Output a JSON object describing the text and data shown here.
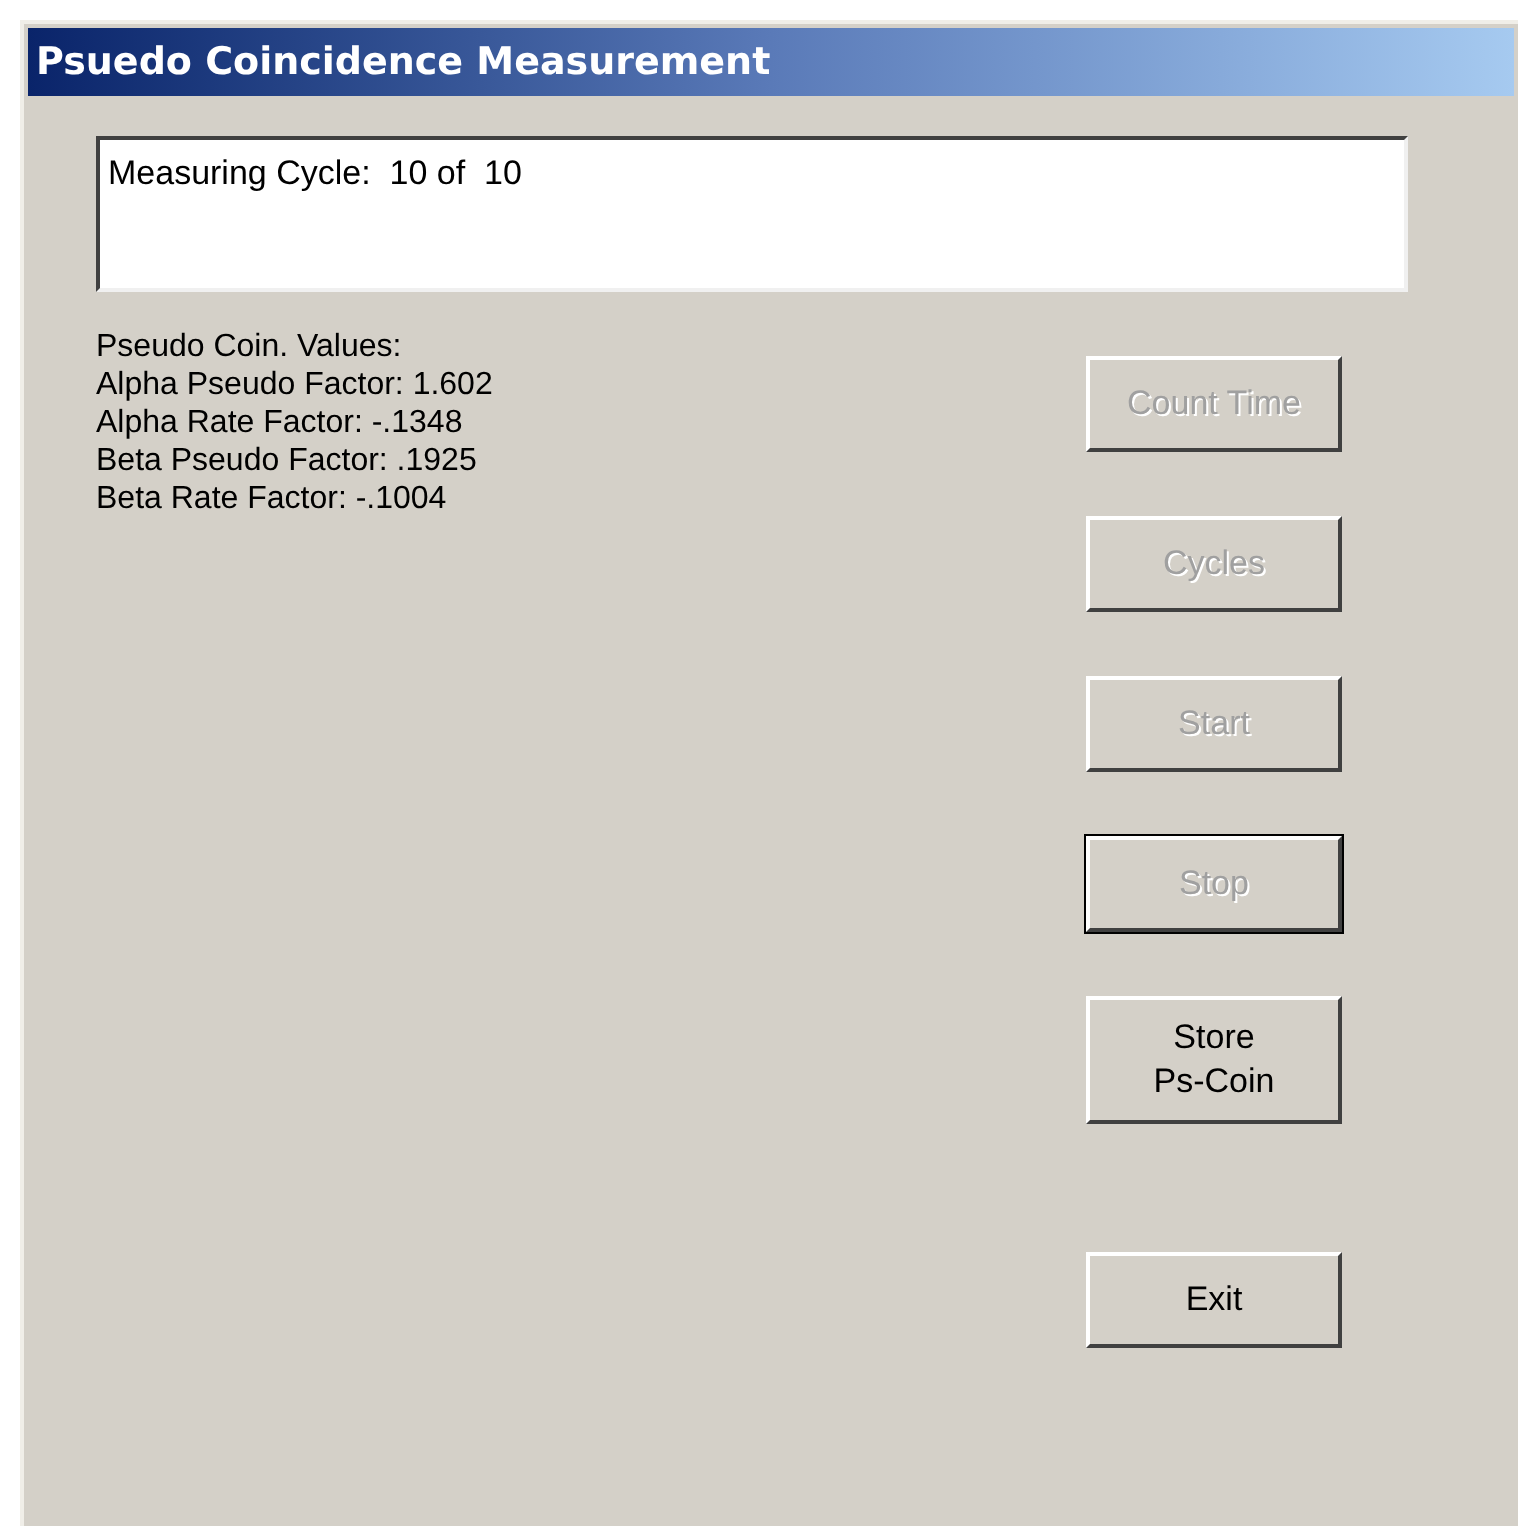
{
  "window": {
    "title": "Psuedo Coincidence Measurement"
  },
  "status_box": {
    "text": "Measuring Cycle:  10 of  10"
  },
  "values": [
    "Pseudo Coin. Values:",
    "Alpha Pseudo Factor: 1.602",
    "Alpha Rate Factor: -.1348",
    "Beta Pseudo Factor: .1925",
    "Beta Rate Factor: -.1004"
  ],
  "button_groups": [
    [
      {
        "label": "Count Time",
        "disabled": true,
        "default": false
      },
      {
        "label": "Cycles",
        "disabled": true,
        "default": false
      },
      {
        "label": "Start",
        "disabled": true,
        "default": false
      },
      {
        "label": "Stop",
        "disabled": true,
        "default": true
      },
      {
        "label": "Store\nPs-Coin",
        "disabled": false,
        "default": false
      }
    ],
    [
      {
        "label": "Exit",
        "disabled": false,
        "default": false
      }
    ]
  ]
}
